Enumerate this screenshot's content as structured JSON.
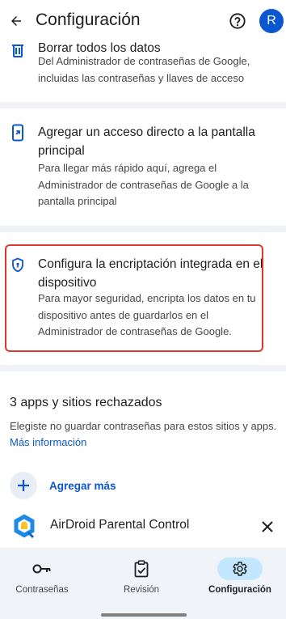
{
  "app_bar": {
    "title": "Configuración",
    "back_icon": "arrow-back-icon",
    "help_icon": "help-circle-icon",
    "avatar_letter": "R"
  },
  "settings": {
    "delete_all": {
      "icon": "trash-icon",
      "title": "Borrar todos los datos",
      "subtitle": "Del Administrador de contraseñas de Google, incluidas las contraseñas y llaves de acceso"
    },
    "shortcut": {
      "icon": "add-to-home-screen-icon",
      "title": "Agregar un acceso directo a la pantalla principal",
      "subtitle": "Para llegar más rápido aquí, agrega el Administrador de contraseñas de Google a la pantalla principal"
    },
    "encryption": {
      "icon": "shield-lock-icon",
      "title": "Configura la encriptación integrada en el dispositivo",
      "subtitle": "Para mayor seguridad, encripta los datos en tu dispositivo antes de guardarlos en el Administrador de contraseñas de Google."
    }
  },
  "rejected": {
    "title": "3 apps y sitios rechazados",
    "description": "Elegiste no guardar contraseñas para estos sitios y apps.",
    "more_info": "Más información",
    "add_more": "Agregar más",
    "items": [
      {
        "name": "AirDroid Parental Control",
        "icon": "airdroid-logo-icon"
      }
    ]
  },
  "bottom_nav": {
    "items": [
      {
        "label": "Contraseñas",
        "icon": "key-icon",
        "active": false
      },
      {
        "label": "Revisión",
        "icon": "clipboard-check-icon",
        "active": false
      },
      {
        "label": "Configuración",
        "icon": "gear-icon",
        "active": true
      }
    ]
  },
  "colors": {
    "accent": "#0b57d0",
    "highlight": "#d93a2b",
    "nav_active_pill": "#c2e7ff",
    "nav_background": "#f0f4f9",
    "divider": "#f0f2f5"
  }
}
